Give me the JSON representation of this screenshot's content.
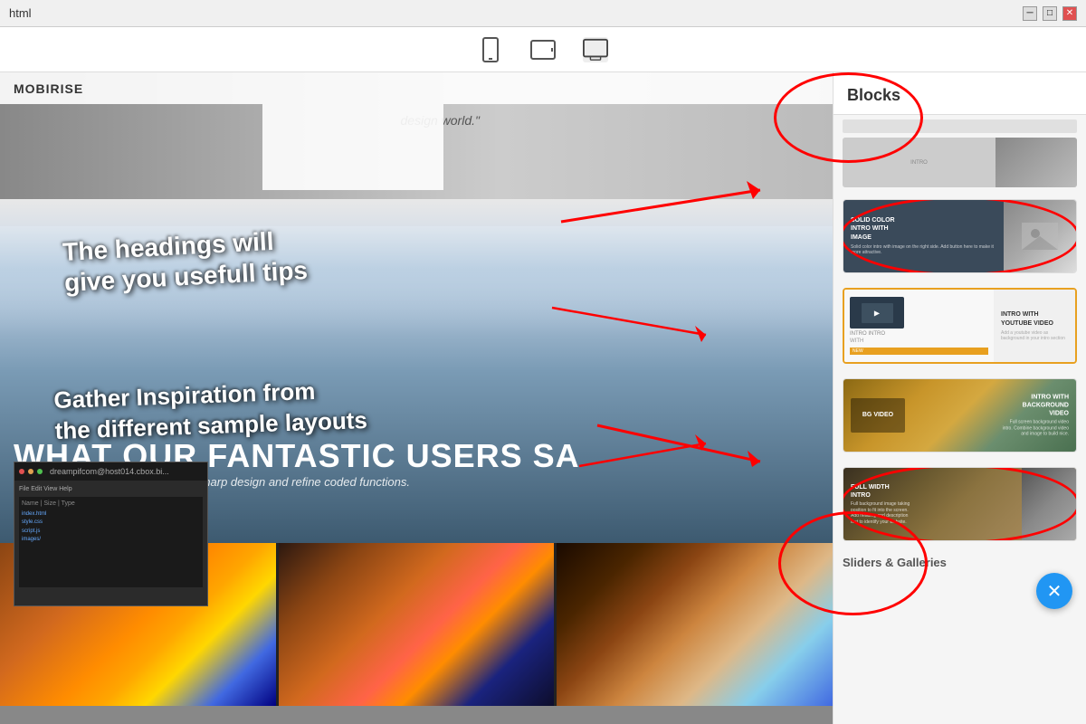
{
  "titlebar": {
    "title": "html",
    "minimize": "─",
    "maximize": "□",
    "close": "✕"
  },
  "toolbar": {
    "mobile_icon": "📱",
    "tablet_icon": "⬜",
    "desktop_icon": "🖥"
  },
  "canvas": {
    "logo_text": "MOBIRISE",
    "design_quote": "design world.\"",
    "tip1_line1": "The headings will",
    "tip1_line2": "give you usefull tips",
    "tip2_line1": "Gather Inspiration from",
    "tip2_line2": "the different sample layouts",
    "section_heading": "WHAT OUR FANTASTIC USERS SA",
    "section_subheading": "Shape your future web project with sharp design and refine coded functions.",
    "chat_title": "dreampifcom@host014.cbox.bi...",
    "chat_content": "File Edit View Help"
  },
  "blocks_panel": {
    "title": "Blocks",
    "items": [
      {
        "id": "solid-color-intro",
        "title": "SOLID COLOR\nINTRO WITH\nIMAGE",
        "desc": "Solid color intro with image on the right side. Add button here to make it more attractive.",
        "circled": true
      },
      {
        "id": "intro-youtube",
        "title": "INTRO WITH\nYOUTUBE VIDEO",
        "badge": "NEW",
        "circled": false,
        "highlighted": true
      },
      {
        "id": "intro-bgvideo",
        "title": "INTRO WITH\nBACKGROUND\nVIDEO",
        "desc": "Full screen background video intro. Combine background video and image to build nice.",
        "circled": false
      },
      {
        "id": "full-width-intro",
        "title": "FULL WIDTH\nINTRO",
        "desc": "Full background image taking position to fit into the screen. Add heading and description text to identify your website.",
        "circled": true
      }
    ],
    "sliders_section": "Sliders & Galleries"
  }
}
